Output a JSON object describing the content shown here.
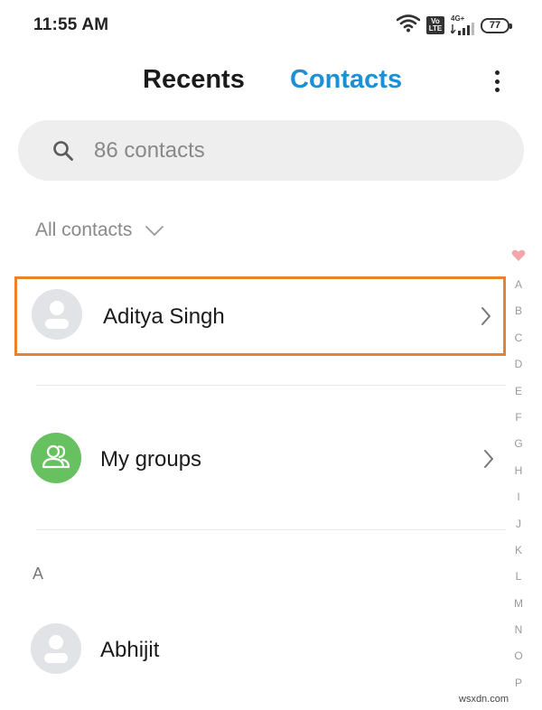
{
  "status_bar": {
    "time": "11:55 AM",
    "volte_label": "Vo LTE",
    "network_label": "4G+",
    "battery": "77"
  },
  "tabs": [
    {
      "label": "Recents",
      "active": false
    },
    {
      "label": "Contacts",
      "active": true
    }
  ],
  "search": {
    "placeholder": "86 contacts"
  },
  "filter": {
    "label": "All contacts"
  },
  "rows": {
    "highlighted_contact": "Aditya Singh",
    "groups": "My groups",
    "contact_1": "Abhijit"
  },
  "section_letter": "A",
  "alphabet_index": [
    "A",
    "B",
    "C",
    "D",
    "E",
    "F",
    "G",
    "H",
    "I",
    "J",
    "K",
    "L",
    "M",
    "N",
    "O",
    "P"
  ],
  "watermark": "wsxdn.com",
  "colors": {
    "accent": "#1c8fd6",
    "highlight_border": "#e8822f",
    "groups_avatar": "#68c160",
    "heart": "#f0a8ad"
  }
}
